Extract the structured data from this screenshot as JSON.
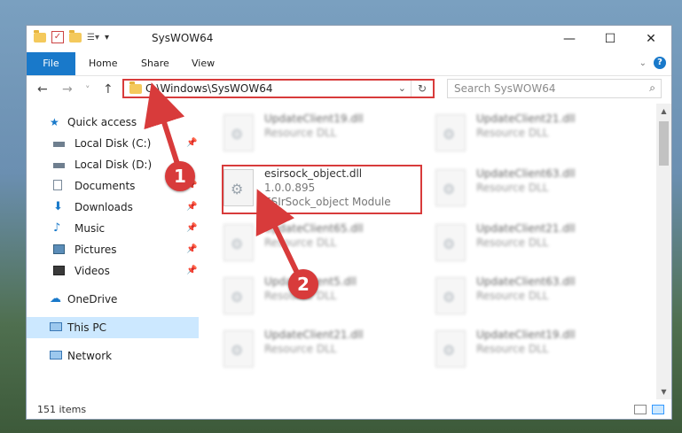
{
  "window": {
    "title": "SysWOW64",
    "minimize": "—",
    "maximize": "☐",
    "close": "✕"
  },
  "ribbon": {
    "tabs": [
      "File",
      "Home",
      "Share",
      "View"
    ]
  },
  "navigation": {
    "back": "←",
    "forward": "→",
    "recent": "˅",
    "up": "↑"
  },
  "address": {
    "path": "C:\\Windows\\SysWOW64"
  },
  "search": {
    "placeholder": "Search SysWOW64"
  },
  "sidebar": {
    "items": [
      {
        "label": "Quick access",
        "icon": "star-icon"
      },
      {
        "label": "Local Disk (C:)",
        "icon": "drive-icon",
        "pinned": true
      },
      {
        "label": "Local Disk (D:)",
        "icon": "drive-icon"
      },
      {
        "label": "Documents",
        "icon": "documents-icon",
        "pinned": true
      },
      {
        "label": "Downloads",
        "icon": "download-icon",
        "pinned": true
      },
      {
        "label": "Music",
        "icon": "music-icon",
        "pinned": true
      },
      {
        "label": "Pictures",
        "icon": "pictures-icon",
        "pinned": true
      },
      {
        "label": "Videos",
        "icon": "videos-icon",
        "pinned": true
      },
      {
        "label": "OneDrive",
        "icon": "cloud-icon"
      },
      {
        "label": "This PC",
        "icon": "computer-icon",
        "selected": true
      },
      {
        "label": "Network",
        "icon": "network-icon"
      }
    ]
  },
  "files": [
    {
      "name": "UpdateClient19.dll",
      "type": "Resource DLL"
    },
    {
      "name": "UpdateClient21.dll",
      "type": "Resource DLL"
    },
    {
      "name": "esirsock_object.dll",
      "version": "1.0.0.895",
      "desc": "ESIrSock_object Module",
      "highlighted": true
    },
    {
      "name": "UpdateClient63.dll",
      "type": "Resource DLL"
    },
    {
      "name": "UpdateClient65.dll",
      "type": "Resource DLL"
    },
    {
      "name": "UpdateClient21.dll",
      "type": "Resource DLL"
    },
    {
      "name": "UpdateClient5.dll",
      "type": "Resource DLL"
    },
    {
      "name": "UpdateClient63.dll",
      "type": "Resource DLL"
    },
    {
      "name": "UpdateClient21.dll",
      "type": "Resource DLL"
    },
    {
      "name": "UpdateClient19.dll",
      "type": "Resource DLL"
    }
  ],
  "status": {
    "item_count": "151 items"
  },
  "callouts": {
    "step1": "1",
    "step2": "2"
  },
  "colors": {
    "accent": "#1979ca",
    "highlight": "#d83b3b",
    "selected_bg": "#cce8ff"
  }
}
